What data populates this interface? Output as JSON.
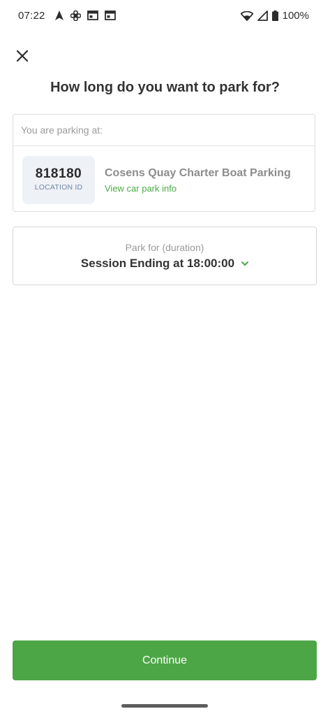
{
  "status_bar": {
    "time": "07:22",
    "left_icons": [
      "navigation-icon",
      "pinwheel-icon",
      "window-icon",
      "window-icon"
    ],
    "right_icons": [
      "wifi-icon",
      "signal-icon",
      "battery-icon"
    ],
    "battery": "100%"
  },
  "header": {
    "close_icon": "close-icon",
    "title": "How long do you want to park for?"
  },
  "location_card": {
    "header_text": "You are parking at:",
    "location_number": "818180",
    "location_id_label": "LOCATION ID",
    "car_park_name": "Cosens Quay Charter Boat Parking",
    "link_text": "View car park info"
  },
  "duration": {
    "label": "Park for (duration)",
    "value": "Session Ending at 18:00:00",
    "dropdown_icon": "chevron-down-icon"
  },
  "footer": {
    "continue_label": "Continue"
  },
  "colors": {
    "accent_green": "#4ca646",
    "link_green": "#4caa46",
    "location_box_bg": "#eef1f6",
    "location_label": "#6f86a6"
  }
}
